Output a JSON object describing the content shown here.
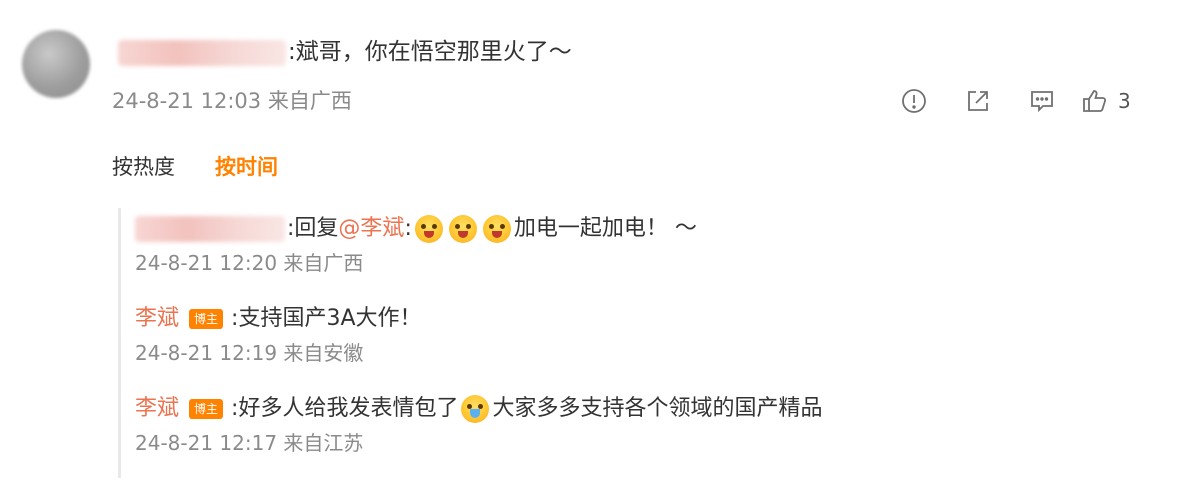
{
  "top_comment": {
    "text": ":斌哥，你在悟空那里火了～",
    "time": "24-8-21 12:03 来自广西",
    "likes": "3"
  },
  "sort": {
    "hot": "按热度",
    "time": "按时间"
  },
  "replies": [
    {
      "prefix": ":回复",
      "mention": "@李斌",
      "after_mention": ":",
      "text": "加电一起加电！ ～",
      "time": "24-8-21 12:20 来自广西"
    },
    {
      "user": "李斌",
      "badge": "博主",
      "text": ":支持国产3A大作！",
      "time": "24-8-21 12:19 来自安徽"
    },
    {
      "user": "李斌",
      "badge": "博主",
      "text_before": ":好多人给我发表情包了",
      "text_after": "大家多多支持各个领域的国产精品",
      "time": "24-8-21 12:17 来自江苏"
    }
  ],
  "icons": [
    "report-icon",
    "share-icon",
    "comment-icon",
    "like-icon"
  ],
  "colors": {
    "accent": "#ff8200",
    "username": "#eb7350",
    "meta": "#8a8a8a"
  }
}
